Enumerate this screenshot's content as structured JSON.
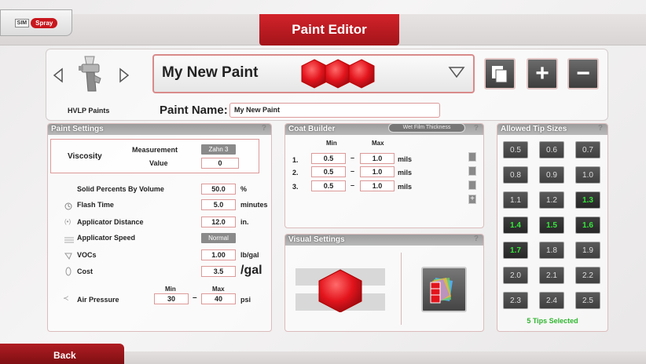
{
  "app": {
    "logo": {
      "sim": "SIM",
      "spray": "Spray"
    },
    "title": "Paint Editor"
  },
  "header": {
    "gun_label": "HVLP Paints",
    "paint_title": "My New Paint",
    "paint_name_label": "Paint Name:",
    "paint_name_value": "My New Paint",
    "paint_color": "#e3141c"
  },
  "paint_settings": {
    "title": "Paint Settings",
    "viscosity": {
      "label": "Viscosity",
      "measurement_label": "Measurement",
      "measurement_value": "Zahn 3",
      "value_label": "Value",
      "value": "0"
    },
    "rows": [
      {
        "icon": "none",
        "label": "Solid Percents By Volume",
        "value": "50.0",
        "unit": "%"
      },
      {
        "icon": "clock-icon",
        "label": "Flash Time",
        "value": "5.0",
        "unit": "minutes"
      },
      {
        "icon": "distance-icon",
        "label": "Applicator Distance",
        "value": "12.0",
        "unit": "in."
      },
      {
        "icon": "speed-icon",
        "label": "Applicator Speed",
        "value": "Normal",
        "unit": ""
      },
      {
        "icon": "voc-icon",
        "label": "VOCs",
        "value": "1.00",
        "unit": "lb/gal"
      },
      {
        "icon": "cost-icon",
        "label": "Cost",
        "value": "3.5",
        "unit": "/gal"
      }
    ],
    "air_pressure": {
      "label": "Air Pressure",
      "min_label": "Min",
      "max_label": "Max",
      "min": "30",
      "max": "40",
      "unit": "psi"
    }
  },
  "coat_builder": {
    "title": "Coat Builder",
    "mode_button": "Wet Film Thickness",
    "min_label": "Min",
    "max_label": "Max",
    "coats": [
      {
        "num": "1.",
        "min": "0.5",
        "max": "1.0",
        "unit": "mils"
      },
      {
        "num": "2.",
        "min": "0.5",
        "max": "1.0",
        "unit": "mils"
      },
      {
        "num": "3.",
        "min": "0.5",
        "max": "1.0",
        "unit": "mils"
      }
    ]
  },
  "visual_settings": {
    "title": "Visual Settings"
  },
  "tip_sizes": {
    "title": "Allowed Tip Sizes",
    "tips": [
      {
        "label": "0.5",
        "selected": false
      },
      {
        "label": "0.6",
        "selected": false
      },
      {
        "label": "0.7",
        "selected": false
      },
      {
        "label": "0.8",
        "selected": false
      },
      {
        "label": "0.9",
        "selected": false
      },
      {
        "label": "1.0",
        "selected": false
      },
      {
        "label": "1.1",
        "selected": false
      },
      {
        "label": "1.2",
        "selected": false
      },
      {
        "label": "1.3",
        "selected": true
      },
      {
        "label": "1.4",
        "selected": true
      },
      {
        "label": "1.5",
        "selected": true
      },
      {
        "label": "1.6",
        "selected": true
      },
      {
        "label": "1.7",
        "selected": true
      },
      {
        "label": "1.8",
        "selected": false
      },
      {
        "label": "1.9",
        "selected": false
      },
      {
        "label": "2.0",
        "selected": false
      },
      {
        "label": "2.1",
        "selected": false
      },
      {
        "label": "2.2",
        "selected": false
      },
      {
        "label": "2.3",
        "selected": false
      },
      {
        "label": "2.4",
        "selected": false
      },
      {
        "label": "2.5",
        "selected": false
      }
    ],
    "summary": "5 Tips Selected"
  },
  "footer": {
    "back_label": "Back"
  },
  "colors": {
    "accent": "#c8161d",
    "selected_tip": "#35e83a"
  }
}
